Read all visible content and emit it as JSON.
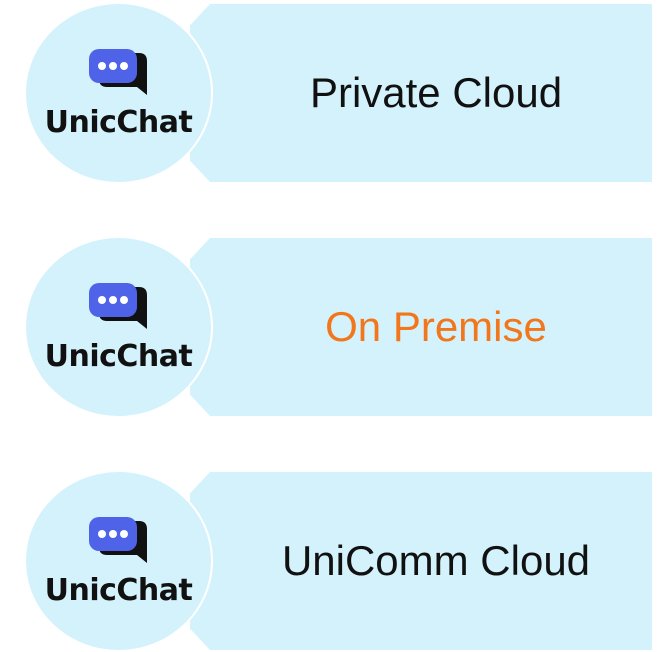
{
  "colors": {
    "banner_bg": "#d3f2fb",
    "logo_blue": "#4f63e8",
    "logo_dark": "#111111",
    "accent": "#f2761c"
  },
  "rows": [
    {
      "logo_text": "UnicChat",
      "label": "Private Cloud"
    },
    {
      "logo_text": "UnicChat",
      "label": "On Premise"
    },
    {
      "logo_text": "UnicChat",
      "label": "UniComm Cloud"
    }
  ]
}
